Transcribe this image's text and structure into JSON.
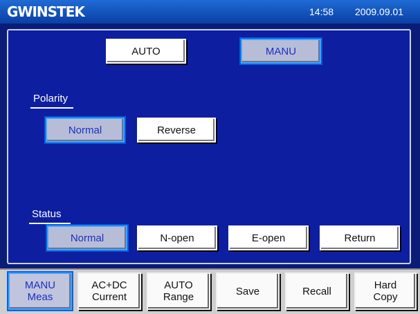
{
  "header": {
    "brand": "GWINSTEK",
    "time": "14:58",
    "date": "2009.09.01"
  },
  "mode": {
    "auto_label": "AUTO",
    "manu_label": "MANU",
    "selected": "MANU"
  },
  "polarity": {
    "title": "Polarity",
    "normal_label": "Normal",
    "reverse_label": "Reverse",
    "selected": "Normal"
  },
  "status": {
    "title": "Status",
    "normal_label": "Normal",
    "nopen_label": "N-open",
    "eopen_label": "E-open",
    "return_label": "Return",
    "selected": "Normal"
  },
  "softkeys": [
    {
      "label": "MANU\nMeas",
      "selected": true
    },
    {
      "label": "AC+DC\nCurrent",
      "selected": false
    },
    {
      "label": "AUTO\nRange",
      "selected": false
    },
    {
      "label": "Save",
      "selected": false
    },
    {
      "label": "Recall",
      "selected": false
    },
    {
      "label": "Hard\nCopy",
      "selected": false
    }
  ],
  "colors": {
    "header": "#0a3fa3",
    "panel": "#0d1fa0",
    "selected_text": "#1930c5",
    "selected_border": "#3aa6ff"
  }
}
